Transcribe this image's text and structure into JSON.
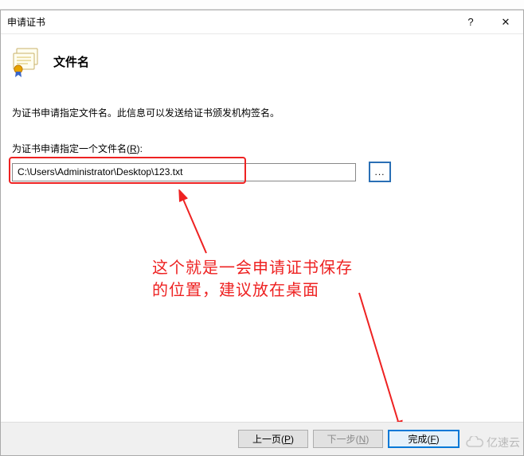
{
  "outer_chrome_text": "",
  "dialog": {
    "title": "申请证书",
    "help_glyph": "?",
    "close_glyph": "✕"
  },
  "header": {
    "heading": "文件名"
  },
  "body": {
    "description": "为证书申请指定文件名。此信息可以发送给证书颁发机构签名。",
    "field_label_prefix": "为证书申请指定一个文件名(",
    "field_label_hotkey": "R",
    "field_label_suffix": "):",
    "path_value": "C:\\Users\\Administrator\\Desktop\\123.txt",
    "browse_label": "..."
  },
  "annotation": {
    "line1": "这个就是一会申请证书保存",
    "line2": "的位置，建议放在桌面"
  },
  "footer": {
    "prev_prefix": "上一页(",
    "prev_hotkey": "P",
    "prev_suffix": ")",
    "next_prefix": "下一步(",
    "next_hotkey": "N",
    "next_suffix": ")",
    "finish_prefix": "完成(",
    "finish_hotkey": "F",
    "finish_suffix": ")"
  },
  "watermark": {
    "text": "亿速云"
  }
}
